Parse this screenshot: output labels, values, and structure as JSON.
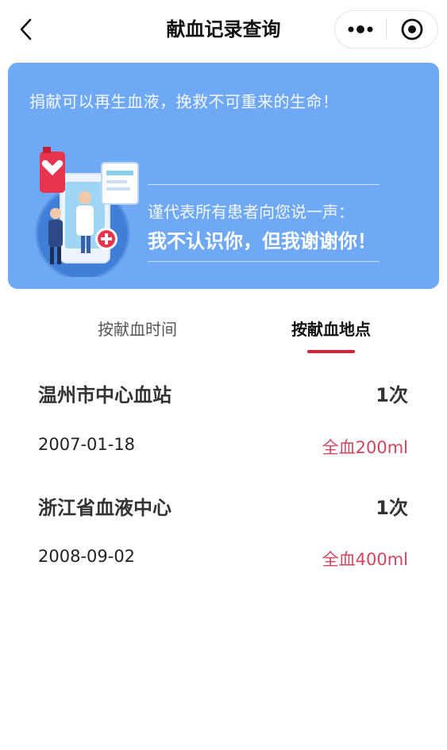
{
  "nav": {
    "title": "献血记录查询",
    "back_icon": "chevron-left-icon",
    "more_icon": "more-dots-icon",
    "close_icon": "target-circle-icon"
  },
  "banner": {
    "slogan": "捐献可以再生血液，挽救不可重来的生命！",
    "sub": "谨代表所有患者向您说一声：",
    "thanks": "我不认识你，但我谢谢你！",
    "bg_color": "#6fa9f5"
  },
  "tabs": [
    {
      "label": "按献血时间",
      "active": false
    },
    {
      "label": "按献血地点",
      "active": true
    }
  ],
  "records": [
    {
      "location": "温州市中心血站",
      "count": "1次",
      "date": "2007-01-18",
      "amount": "全血200ml"
    },
    {
      "location": "浙江省血液中心",
      "count": "1次",
      "date": "2008-09-02",
      "amount": "全血400ml"
    }
  ],
  "colors": {
    "accent": "#d8213a",
    "amount_text": "#d0455e"
  }
}
